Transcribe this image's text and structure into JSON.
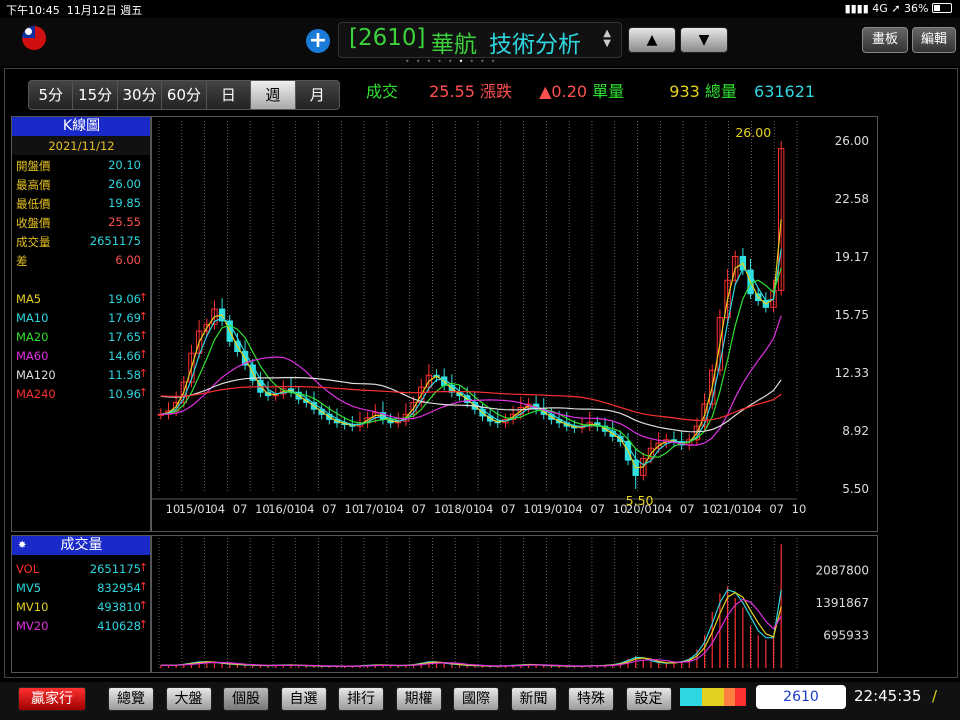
{
  "status_bar": {
    "time": "下午10:45",
    "date": "11月12日 週五",
    "network": "4G",
    "battery": "36%"
  },
  "header": {
    "stock_code": "[2610]",
    "stock_name": "華航",
    "view_title": "技術分析",
    "up_label": "▲",
    "down_label": "▼",
    "draw_button": "畫板",
    "edit_button": "編輯"
  },
  "period_tabs": [
    "5分",
    "15分",
    "30分",
    "60分",
    "日",
    "週",
    "月"
  ],
  "selected_period": "週",
  "quote": {
    "trade_label": "成交",
    "trade_value": "25.55",
    "change_label": "漲跌",
    "change_value": "▲0.20",
    "unit_vol_label": "單量",
    "unit_vol_value": "933",
    "total_vol_label": "總量",
    "total_vol_value": "631621"
  },
  "k_panel": {
    "title": "K線圖",
    "date": "2021/11/12",
    "rows": [
      {
        "label": "開盤價",
        "value": "20.10",
        "color": "#2ed6e0"
      },
      {
        "label": "最高價",
        "value": "26.00",
        "color": "#2ed6e0"
      },
      {
        "label": "最低價",
        "value": "19.85",
        "color": "#2ed6e0"
      },
      {
        "label": "收盤價",
        "value": "25.55",
        "color": "#ff5050"
      },
      {
        "label": "成交量",
        "value": "2651175",
        "color": "#2ed6e0"
      },
      {
        "label": "差",
        "value": "6.00",
        "color": "#ff5050"
      }
    ],
    "ma": [
      {
        "label": "MA5",
        "value": "19.06",
        "color": "#e4d020",
        "arrow": "↑"
      },
      {
        "label": "MA10",
        "value": "17.69",
        "color": "#2ed6e0",
        "arrow": "↑"
      },
      {
        "label": "MA20",
        "value": "17.65",
        "color": "#30e030",
        "arrow": "↑"
      },
      {
        "label": "MA60",
        "value": "14.66",
        "color": "#e030e0",
        "arrow": "↑"
      },
      {
        "label": "MA120",
        "value": "11.58",
        "color": "#dddddd",
        "arrow": "↑"
      },
      {
        "label": "MA240",
        "value": "10.96",
        "color": "#ff3030",
        "arrow": "↑"
      }
    ]
  },
  "vol_panel": {
    "title": "成交量",
    "rows": [
      {
        "label": "VOL",
        "value": "2651175",
        "label_color": "#ff3030",
        "arrow": "↑"
      },
      {
        "label": "MV5",
        "value": "832954",
        "label_color": "#2ed6e0",
        "arrow": "↑"
      },
      {
        "label": "MV10",
        "value": "493810",
        "label_color": "#e4d020",
        "arrow": "↑"
      },
      {
        "label": "MV20",
        "value": "410628",
        "label_color": "#e030e0",
        "arrow": "↑"
      }
    ]
  },
  "chart_data": [
    {
      "type": "candlestick",
      "y_ticks": [
        "26.00",
        "22.58",
        "19.17",
        "15.75",
        "12.33",
        "8.92",
        "5.50"
      ],
      "ylim": [
        5.5,
        26.0
      ],
      "x_ticks": [
        "10",
        "15/01",
        "04",
        "07",
        "10",
        "16/01",
        "04",
        "07",
        "10",
        "17/01",
        "04",
        "07",
        "10",
        "18/01",
        "04",
        "07",
        "10",
        "19/01",
        "04",
        "07",
        "10",
        "20/01",
        "04",
        "07",
        "10",
        "21/01",
        "04",
        "07",
        "10"
      ],
      "annotations": [
        {
          "text": "26.00",
          "label": "high"
        },
        {
          "text": "5.50",
          "label": "low"
        }
      ],
      "closes": [
        9.9,
        10.1,
        10.6,
        11.8,
        13.5,
        14.8,
        15.2,
        16.1,
        15.4,
        14.2,
        13.6,
        12.8,
        11.9,
        11.2,
        11.0,
        11.1,
        11.4,
        11.2,
        10.8,
        10.6,
        10.2,
        9.9,
        9.6,
        9.4,
        9.3,
        9.2,
        9.4,
        9.7,
        10.0,
        9.6,
        9.4,
        9.5,
        9.9,
        10.6,
        11.5,
        12.2,
        12.1,
        11.6,
        11.2,
        11.0,
        10.6,
        10.2,
        9.8,
        9.5,
        9.4,
        9.6,
        9.9,
        10.3,
        10.5,
        10.2,
        9.9,
        9.6,
        9.4,
        9.2,
        9.1,
        9.2,
        9.4,
        9.2,
        8.9,
        8.6,
        8.3,
        7.2,
        6.3,
        7.3,
        7.9,
        8.2,
        8.4,
        8.3,
        8.1,
        8.4,
        9.2,
        10.5,
        12.5,
        15.6,
        17.8,
        19.2,
        18.4,
        17.0,
        16.6,
        16.2,
        17.2,
        25.55
      ],
      "series": [
        {
          "name": "MA5",
          "color": "#e4d020"
        },
        {
          "name": "MA10",
          "color": "#2ed6e0"
        },
        {
          "name": "MA20",
          "color": "#30e030"
        },
        {
          "name": "MA60",
          "color": "#e030e0"
        },
        {
          "name": "MA120",
          "color": "#dddddd"
        },
        {
          "name": "MA240",
          "color": "#ff3030"
        }
      ]
    },
    {
      "type": "bar",
      "y_ticks": [
        "2087800",
        "1391867",
        "695933"
      ],
      "ylim": [
        0,
        2700000
      ],
      "volumes": [
        60000,
        50000,
        70000,
        90000,
        120000,
        140000,
        130000,
        110000,
        90000,
        80000,
        70000,
        60000,
        60000,
        50000,
        50000,
        60000,
        70000,
        60000,
        50000,
        50000,
        40000,
        40000,
        40000,
        40000,
        40000,
        40000,
        50000,
        60000,
        70000,
        60000,
        50000,
        50000,
        60000,
        80000,
        120000,
        140000,
        120000,
        90000,
        80000,
        60000,
        50000,
        50000,
        40000,
        40000,
        40000,
        50000,
        60000,
        70000,
        80000,
        60000,
        50000,
        50000,
        40000,
        40000,
        40000,
        40000,
        50000,
        50000,
        60000,
        80000,
        120000,
        200000,
        260000,
        180000,
        130000,
        110000,
        100000,
        120000,
        150000,
        220000,
        400000,
        700000,
        1200000,
        1600000,
        1750000,
        1500000,
        1300000,
        900000,
        700000,
        600000,
        700000,
        2651175
      ],
      "series": [
        {
          "name": "VOL",
          "color": "#ff3030"
        },
        {
          "name": "MV5",
          "color": "#2ed6e0"
        },
        {
          "name": "MV10",
          "color": "#e4d020"
        },
        {
          "name": "MV20",
          "color": "#e030e0"
        }
      ]
    }
  ],
  "bottom_nav": {
    "brand": "贏家行",
    "items": [
      "總覽",
      "大盤",
      "個股",
      "自選",
      "排行",
      "期權",
      "國際",
      "新聞",
      "特殊",
      "設定"
    ],
    "selected": "個股",
    "ticker_input": "2610",
    "clock": "22:45:35",
    "clock_suffix": "/"
  }
}
